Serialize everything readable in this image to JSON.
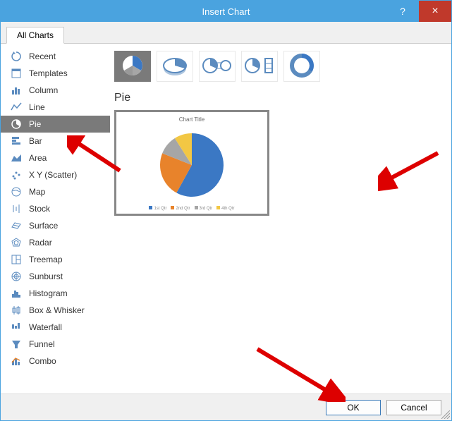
{
  "window": {
    "title": "Insert Chart",
    "help_tooltip": "?",
    "close_tooltip": "×"
  },
  "tabs": {
    "all_charts": "All Charts"
  },
  "sidebar": {
    "items": [
      {
        "label": "Recent",
        "icon": "recent-icon"
      },
      {
        "label": "Templates",
        "icon": "templates-icon"
      },
      {
        "label": "Column",
        "icon": "column-icon"
      },
      {
        "label": "Line",
        "icon": "line-icon"
      },
      {
        "label": "Pie",
        "icon": "pie-icon",
        "selected": true
      },
      {
        "label": "Bar",
        "icon": "bar-icon"
      },
      {
        "label": "Area",
        "icon": "area-icon"
      },
      {
        "label": "X Y (Scatter)",
        "icon": "scatter-icon"
      },
      {
        "label": "Map",
        "icon": "map-icon"
      },
      {
        "label": "Stock",
        "icon": "stock-icon"
      },
      {
        "label": "Surface",
        "icon": "surface-icon"
      },
      {
        "label": "Radar",
        "icon": "radar-icon"
      },
      {
        "label": "Treemap",
        "icon": "treemap-icon"
      },
      {
        "label": "Sunburst",
        "icon": "sunburst-icon"
      },
      {
        "label": "Histogram",
        "icon": "histogram-icon"
      },
      {
        "label": "Box & Whisker",
        "icon": "boxwhisker-icon"
      },
      {
        "label": "Waterfall",
        "icon": "waterfall-icon"
      },
      {
        "label": "Funnel",
        "icon": "funnel-icon"
      },
      {
        "label": "Combo",
        "icon": "combo-icon"
      }
    ]
  },
  "main": {
    "section_title": "Pie",
    "subtypes": [
      {
        "name": "pie-2d",
        "selected": true
      },
      {
        "name": "pie-3d",
        "selected": false
      },
      {
        "name": "pie-of-pie",
        "selected": false
      },
      {
        "name": "bar-of-pie",
        "selected": false
      },
      {
        "name": "doughnut",
        "selected": false
      }
    ],
    "preview": {
      "title": "Chart Title",
      "legend": [
        "1st Qtr",
        "2nd Qtr",
        "3rd Qtr",
        "4th Qtr"
      ]
    }
  },
  "footer": {
    "ok": "OK",
    "cancel": "Cancel"
  },
  "chart_data": {
    "type": "pie",
    "title": "Chart Title",
    "categories": [
      "1st Qtr",
      "2nd Qtr",
      "3rd Qtr",
      "4th Qtr"
    ],
    "values": [
      58,
      23,
      10,
      9
    ],
    "colors": [
      "#3b78c4",
      "#e8832b",
      "#a6a6a6",
      "#f2c744"
    ]
  }
}
